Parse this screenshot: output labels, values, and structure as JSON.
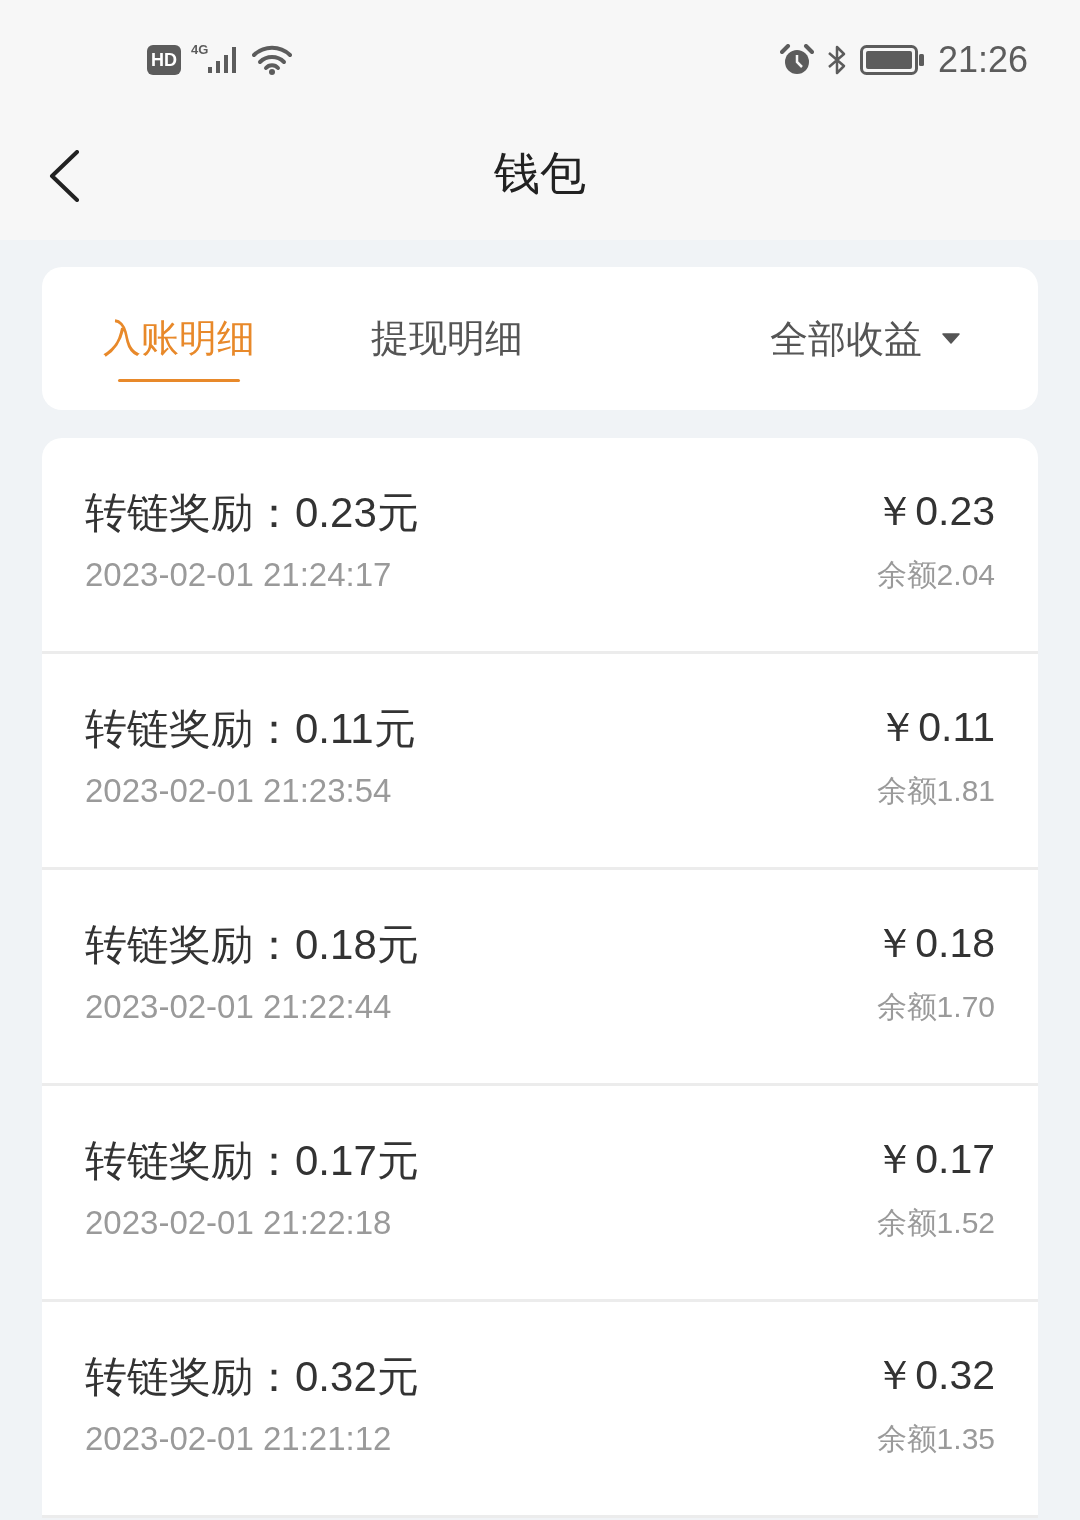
{
  "status_bar": {
    "hd_badge": "HD",
    "network": "4G",
    "time": "21:26"
  },
  "header": {
    "title": "钱包"
  },
  "tabs": [
    {
      "label": "入账明细",
      "selected": true
    },
    {
      "label": "提现明细",
      "selected": false
    }
  ],
  "filter": {
    "label": "全部收益"
  },
  "records": [
    {
      "title": "转链奖励：0.23元",
      "time": "2023-02-01 21:24:17",
      "amount": "￥0.23",
      "balance": "余额2.04"
    },
    {
      "title": "转链奖励：0.11元",
      "time": "2023-02-01 21:23:54",
      "amount": "￥0.11",
      "balance": "余额1.81"
    },
    {
      "title": "转链奖励：0.18元",
      "time": "2023-02-01 21:22:44",
      "amount": "￥0.18",
      "balance": "余额1.70"
    },
    {
      "title": "转链奖励：0.17元",
      "time": "2023-02-01 21:22:18",
      "amount": "￥0.17",
      "balance": "余额1.52"
    },
    {
      "title": "转链奖励：0.32元",
      "time": "2023-02-01 21:21:12",
      "amount": "￥0.32",
      "balance": "余额1.35"
    }
  ]
}
